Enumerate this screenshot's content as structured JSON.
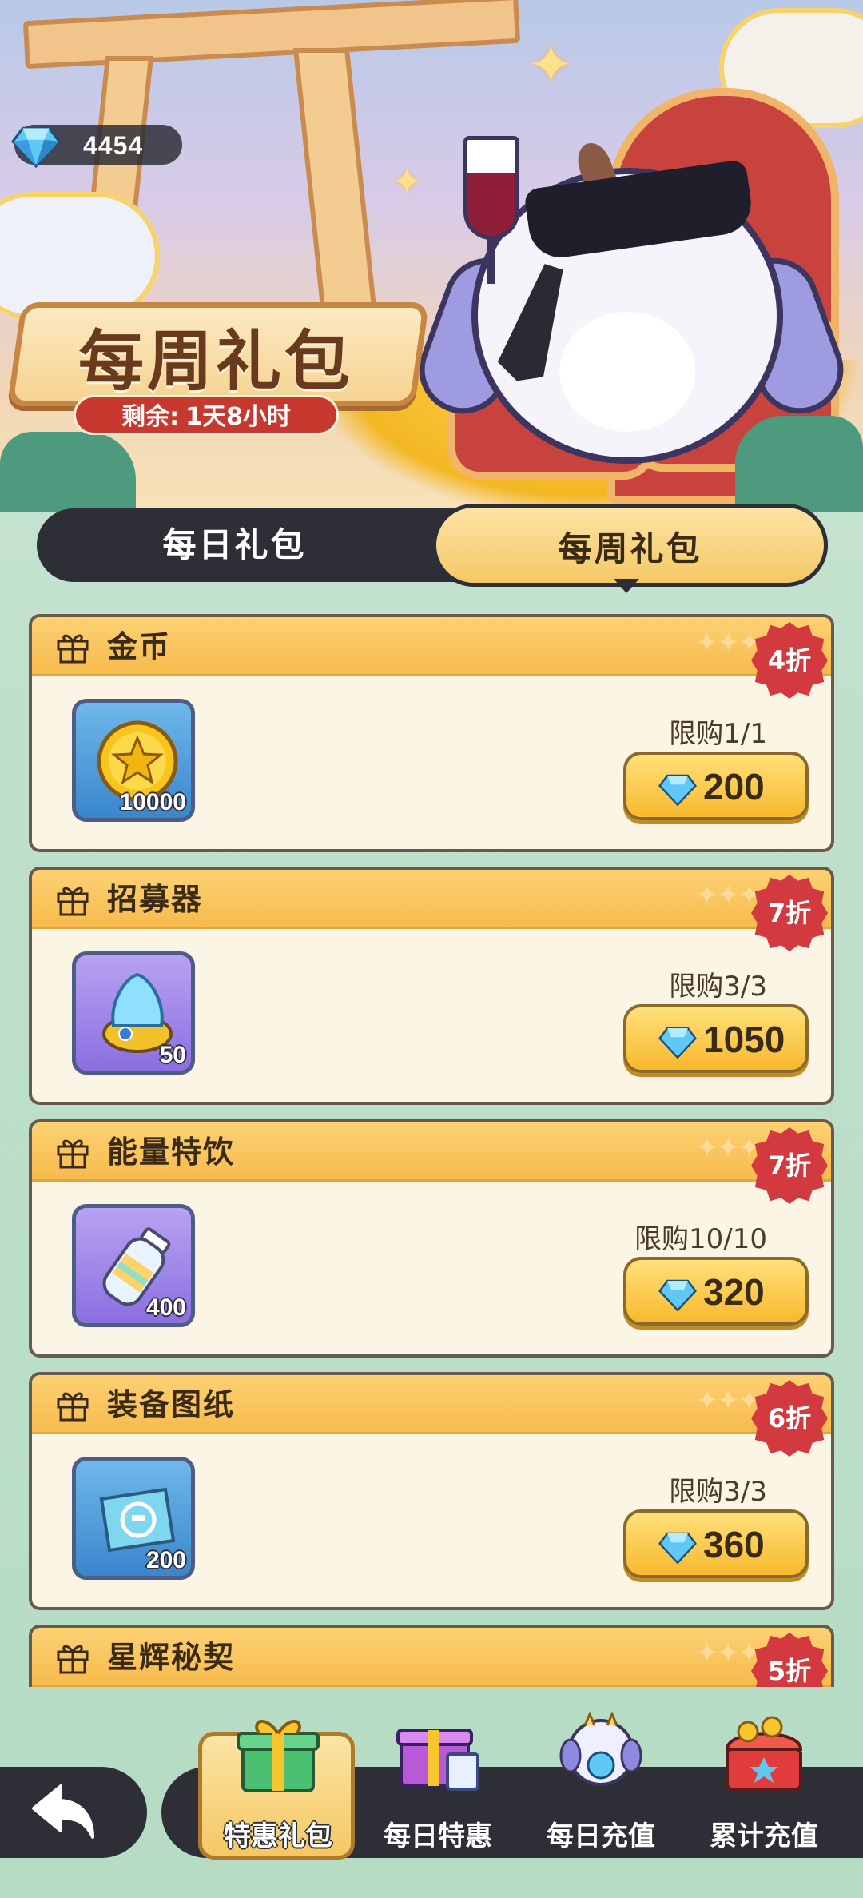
{
  "header": {
    "currency": {
      "icon": "diamond-gem-icon",
      "value": "4454"
    },
    "title": "每周礼包",
    "timer": {
      "label": "剩余:",
      "value": "1天8小时"
    }
  },
  "tabs": [
    {
      "label": "每日礼包",
      "selected": false
    },
    {
      "label": "每周礼包",
      "selected": true
    }
  ],
  "packages": [
    {
      "name": "金币",
      "discount": "4折",
      "item_icon": "gold-coin-icon",
      "quantity": "10000",
      "limit": "限购1/1",
      "price": "200",
      "tile": "blue"
    },
    {
      "name": "招募器",
      "discount": "7折",
      "item_icon": "recruiter-device-icon",
      "quantity": "50",
      "limit": "限购3/3",
      "price": "1050",
      "tile": "purple"
    },
    {
      "name": "能量特饮",
      "discount": "7折",
      "item_icon": "energy-drink-bottle-icon",
      "quantity": "400",
      "limit": "限购10/10",
      "price": "320",
      "tile": "purple"
    },
    {
      "name": "装备图纸",
      "discount": "6折",
      "item_icon": "equipment-blueprint-icon",
      "quantity": "200",
      "limit": "限购3/3",
      "price": "360",
      "tile": "blue"
    },
    {
      "name": "星辉秘契",
      "discount": "5折",
      "item_icon": "",
      "quantity": "",
      "limit": "",
      "price": "",
      "tile": "blue"
    }
  ],
  "bottom_nav": {
    "back": {
      "icon": "back-arrow-icon"
    },
    "items": [
      {
        "label": "特惠礼包",
        "icon": "gift-box-icon",
        "active": true
      },
      {
        "label": "每日特惠",
        "icon": "daily-deal-box-icon",
        "active": false
      },
      {
        "label": "每日充值",
        "icon": "recharge-mascot-icon",
        "active": false
      },
      {
        "label": "累计充值",
        "icon": "treasure-chest-icon",
        "active": false
      }
    ]
  },
  "colors": {
    "accent_gold": "#f7b92e",
    "badge_red": "#d23a3f",
    "dark_bar": "#2e2e36",
    "card_bg": "#fbf5e6"
  }
}
